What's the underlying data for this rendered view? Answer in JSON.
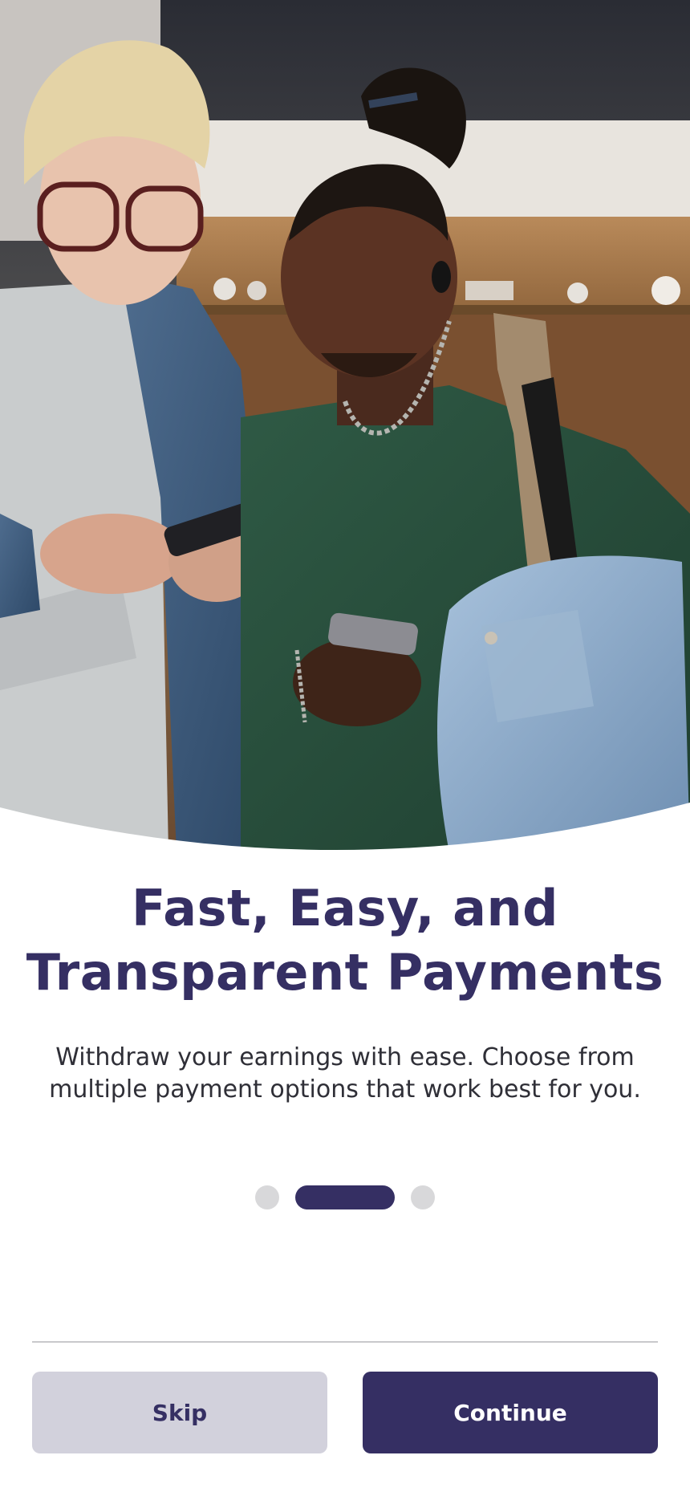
{
  "onboarding": {
    "title_line1": "Fast, Easy, and",
    "title_line2": "Transparent Payments",
    "description": "Withdraw your earnings with ease. Choose from multiple payment options that work best for you.",
    "pager": {
      "total": 3,
      "active_index": 1
    },
    "buttons": {
      "skip_label": "Skip",
      "continue_label": "Continue"
    },
    "colors": {
      "primary": "#352f63",
      "skip_bg": "#d2d1dc",
      "dot_inactive": "#d8d8da"
    }
  }
}
